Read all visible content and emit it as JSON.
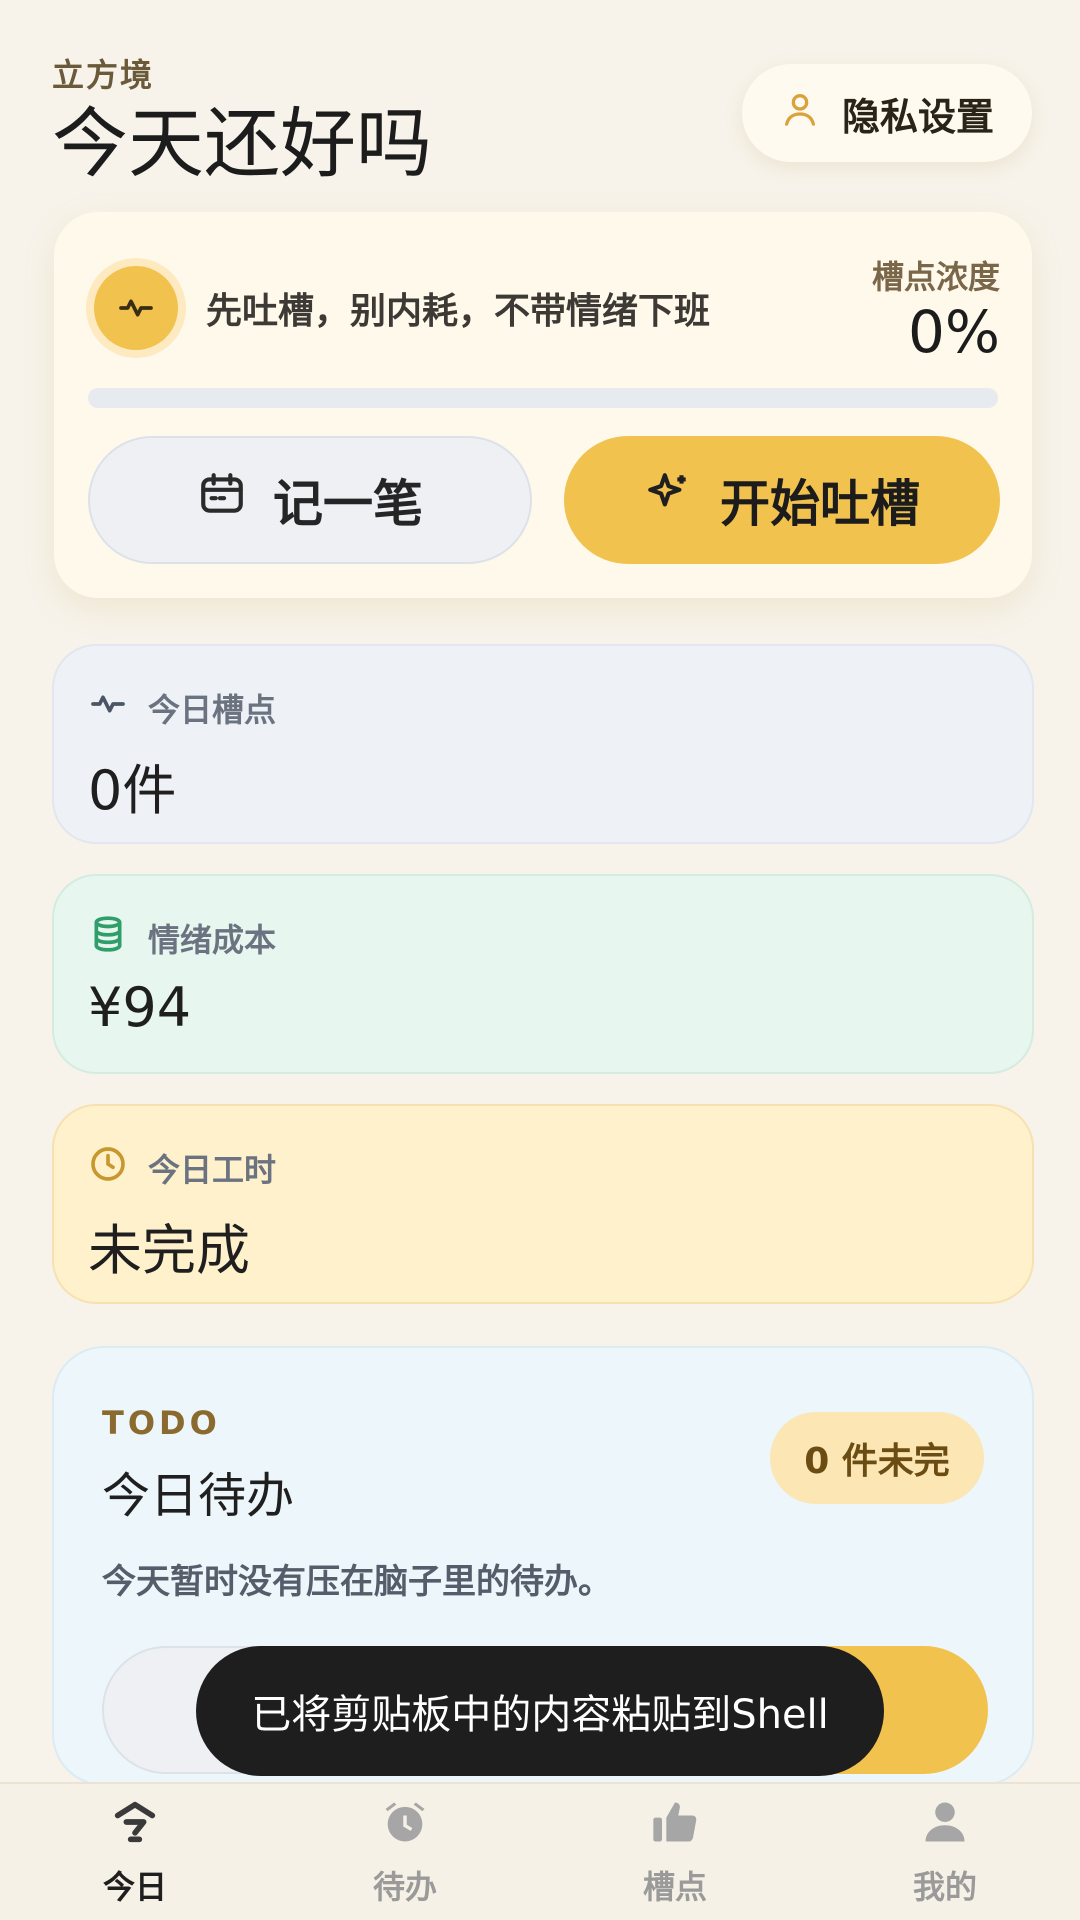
{
  "header": {
    "app_name": "立方境",
    "greeting": "今天还好吗",
    "privacy_label": "隐私设置"
  },
  "hero": {
    "slogan": "先吐槽，别内耗，不带情绪下班",
    "density_label": "槽点浓度",
    "density_value": "0%",
    "density_percent": 0,
    "note_label": "记一笔",
    "start_label": "开始吐槽"
  },
  "stats": {
    "spots_label": "今日槽点",
    "spots_value": "0件",
    "cost_label": "情绪成本",
    "cost_value": "¥94",
    "hours_label": "今日工时",
    "hours_value": "未完成"
  },
  "todo": {
    "tag": "TODO",
    "title": "今日待办",
    "badge": "0 件未完",
    "empty_text": "今天暂时没有压在脑子里的待办。"
  },
  "toast": "已将剪贴板中的内容粘贴到Shell",
  "tabs": [
    {
      "label": "今日",
      "icon": "today-icon",
      "active": true
    },
    {
      "label": "待办",
      "icon": "alarm-icon",
      "active": false
    },
    {
      "label": "槽点",
      "icon": "thumbs-up-icon",
      "active": false
    },
    {
      "label": "我的",
      "icon": "person-icon",
      "active": false
    }
  ],
  "colors": {
    "accent": "#f2c24f",
    "background": "#f7f3ea"
  }
}
